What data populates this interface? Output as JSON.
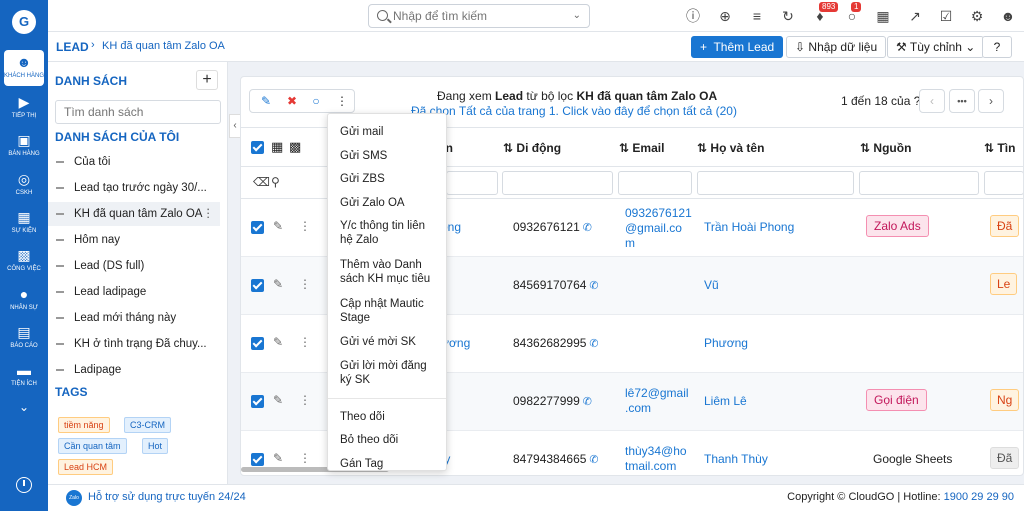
{
  "rail": {
    "logo": "G",
    "items": [
      {
        "label": "Khách hàng",
        "icon": "users-icon"
      },
      {
        "label": "Tiếp thị",
        "icon": "megaphone-icon"
      },
      {
        "label": "Bán hàng",
        "icon": "cart-icon"
      },
      {
        "label": "CSKH",
        "icon": "lifebuoy-icon"
      },
      {
        "label": "Sự kiện",
        "icon": "calendar-icon"
      },
      {
        "label": "Công việc",
        "icon": "briefcase-icon"
      },
      {
        "label": "Nhân sự",
        "icon": "person-icon"
      },
      {
        "label": "Báo cáo",
        "icon": "chart-icon"
      },
      {
        "label": "Tiện ích",
        "icon": "car-icon"
      }
    ]
  },
  "topbar": {
    "search_placeholder": "Nhập để tìm kiếm",
    "notif_count": "893",
    "chat_count": "1"
  },
  "breadcrumb": {
    "root": "LEAD",
    "current": "KH đã quan tâm Zalo OA"
  },
  "actions": {
    "add_lead": "Thêm Lead",
    "import": "Nhập dữ liệu",
    "customize": "Tùy chỉnh"
  },
  "left_panel": {
    "title": "DANH SÁCH",
    "search_placeholder": "Tìm danh sách",
    "my_lists_title": "DANH SÁCH CỦA TÔI",
    "lists": [
      "Của tôi",
      "Lead tạo trước ngày 30/...",
      "KH đã quan tâm Zalo OA",
      "Hôm nay",
      "Lead (DS full)",
      "Lead ladipage",
      "Lead mới tháng này",
      "KH ở tình trạng Đã chuy...",
      "Ladipage"
    ],
    "tags_title": "TAGS",
    "tags": [
      "tiềm năng",
      "C3-CRM",
      "Cần quan tâm",
      "Hot",
      "Lead HCM"
    ]
  },
  "main": {
    "info_prefix": "Đang xem ",
    "info_lead": "Lead",
    "info_mid": " từ bộ lọc ",
    "info_filter": "KH đã quan tâm Zalo OA",
    "info_select": "Đã chọn Tất cả của trang 1. Click vào đây để chọn tất cả (20)",
    "paging": "1 đến 18 của",
    "paging_q": "?",
    "more": "•••",
    "columns": [
      "ên",
      "Di động",
      "Email",
      "Họ và tên",
      "Nguồn",
      "Tìn"
    ],
    "rows": [
      {
        "name": "ong",
        "mobile": "0932676121",
        "email": [
          "0932676121",
          "@gmail.co",
          "m"
        ],
        "fullname": "Trần Hoài Phong",
        "source": "Zalo Ads",
        "edge": "Đã"
      },
      {
        "name": "",
        "mobile": "84569170764",
        "email": [],
        "fullname": "Vũ",
        "source": "",
        "edge": "Le"
      },
      {
        "name": "ương",
        "mobile": "84362682995",
        "email": [],
        "fullname": "Phương",
        "source": "",
        "edge": ""
      },
      {
        "name": "",
        "mobile": "0982277999",
        "email": [
          "lê72@gmail",
          ".com"
        ],
        "fullname": "Liêm Lê",
        "source": "Gọi điện",
        "edge": "Ng"
      },
      {
        "name": "ıy",
        "mobile": "84794384665",
        "email": [
          "thùy34@ho",
          "tmail.com"
        ],
        "fullname": "Thanh Thùy",
        "source": "Google Sheets",
        "edge": "Đã"
      }
    ]
  },
  "dropdown": [
    "Gửi mail",
    "Gửi SMS",
    "Gửi ZBS",
    "Gửi Zalo OA",
    "Y/c thông tin liên hệ Zalo",
    "Thêm vào Danh sách KH mục tiêu",
    "Cập nhật Mautic Stage",
    "Gửi vé mời SK",
    "Gửi lời mời đăng ký SK",
    "Theo dõi",
    "Bỏ theo dõi",
    "Gán Tag"
  ],
  "footer": {
    "zalo": "Zalo",
    "support": "Hỗ trợ sử dụng trực tuyến 24/24",
    "copyright": "Copyright © CloudGO | Hotline: ",
    "hotline": "1900 29 29 90"
  }
}
